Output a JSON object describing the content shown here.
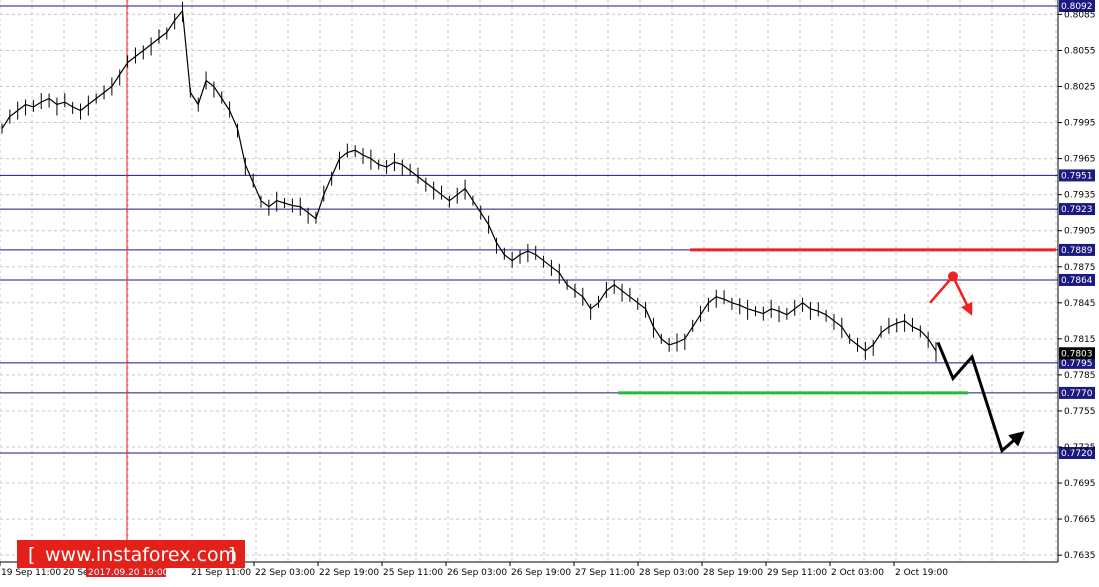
{
  "chart_data": {
    "type": "line",
    "instrument_note": "",
    "ylim": [
      0.762,
      0.8095
    ],
    "y_ticks": [
      "0.8085",
      "0.8055",
      "0.8025",
      "0.7995",
      "0.7965",
      "0.7935",
      "0.7905",
      "0.7875",
      "0.7845",
      "0.7815",
      "0.7785",
      "0.7755",
      "0.7725",
      "0.7695",
      "0.7665",
      "0.7635"
    ],
    "x_ticks": [
      "19 Sep 11:00",
      "20 Sep",
      "2017.09.20 19:00",
      "21 Sep 11:00",
      "22 Sep 03:00",
      "22 Sep 19:00",
      "25 Sep 11:00",
      "26 Sep 03:00",
      "26 Sep 19:00",
      "27 Sep 11:00",
      "28 Sep 03:00",
      "28 Sep 19:00",
      "29 Sep 11:00",
      "2 Oct 03:00",
      "2 Oct 19:00"
    ],
    "highlighted_time": "2017.09.20 19:00",
    "levels": [
      {
        "value": 0.8092,
        "label": "0.8092"
      },
      {
        "value": 0.7951,
        "label": "0.7951"
      },
      {
        "value": 0.7923,
        "label": "0.7923"
      },
      {
        "value": 0.7889,
        "label": "0.7889"
      },
      {
        "value": 0.7864,
        "label": "0.7864"
      },
      {
        "value": 0.7795,
        "label": "0.7795"
      },
      {
        "value": 0.777,
        "label": "0.7770"
      },
      {
        "value": 0.772,
        "label": "0.7720"
      }
    ],
    "current_price": {
      "value": 0.7803,
      "label": "0.7803"
    },
    "price_path": [
      0.799,
      0.8,
      0.8005,
      0.801,
      0.8008,
      0.8012,
      0.8015,
      0.801,
      0.8012,
      0.8008,
      0.8005,
      0.801,
      0.8015,
      0.802,
      0.8025,
      0.8035,
      0.8045,
      0.805,
      0.8055,
      0.806,
      0.8065,
      0.807,
      0.808,
      0.8088,
      0.802,
      0.801,
      0.803,
      0.8025,
      0.8015,
      0.8005,
      0.799,
      0.796,
      0.7945,
      0.793,
      0.7925,
      0.793,
      0.7928,
      0.7926,
      0.7925,
      0.792,
      0.7915,
      0.7935,
      0.795,
      0.7965,
      0.797,
      0.7972,
      0.7968,
      0.7965,
      0.796,
      0.7958,
      0.7962,
      0.796,
      0.7955,
      0.795,
      0.7945,
      0.794,
      0.7935,
      0.793,
      0.7935,
      0.794,
      0.793,
      0.792,
      0.791,
      0.7895,
      0.7885,
      0.788,
      0.7885,
      0.7888,
      0.7885,
      0.788,
      0.7875,
      0.787,
      0.786,
      0.7855,
      0.785,
      0.784,
      0.7845,
      0.7855,
      0.786,
      0.7855,
      0.785,
      0.7845,
      0.784,
      0.7825,
      0.7815,
      0.781,
      0.7812,
      0.7815,
      0.7825,
      0.7835,
      0.7845,
      0.785,
      0.7848,
      0.7845,
      0.7843,
      0.784,
      0.7838,
      0.7836,
      0.784,
      0.7838,
      0.7835,
      0.784,
      0.7845,
      0.784,
      0.7838,
      0.7835,
      0.783,
      0.7825,
      0.7815,
      0.781,
      0.7805,
      0.781,
      0.782,
      0.7825,
      0.7828,
      0.783,
      0.7825,
      0.7822,
      0.7815,
      0.7805
    ],
    "forecast_path": [
      0.7812,
      0.7782,
      0.78,
      0.7722,
      0.7735
    ],
    "alt_path": [
      0.7845,
      0.7867,
      0.7838
    ],
    "resistance_segment": {
      "value": 0.7889,
      "color": "#ee2222"
    },
    "support_segment": {
      "value": 0.777,
      "color": "#22bb33"
    }
  },
  "watermark": {
    "text": "www.instaforex.com"
  },
  "colors": {
    "grid": "#c8c8c8",
    "level_line": "#1a1a80",
    "level_label_bg": "#1a1a80",
    "highlight_bg": "#dd2222",
    "watermark_bg": "#e32019",
    "vline": "#ee2222"
  }
}
